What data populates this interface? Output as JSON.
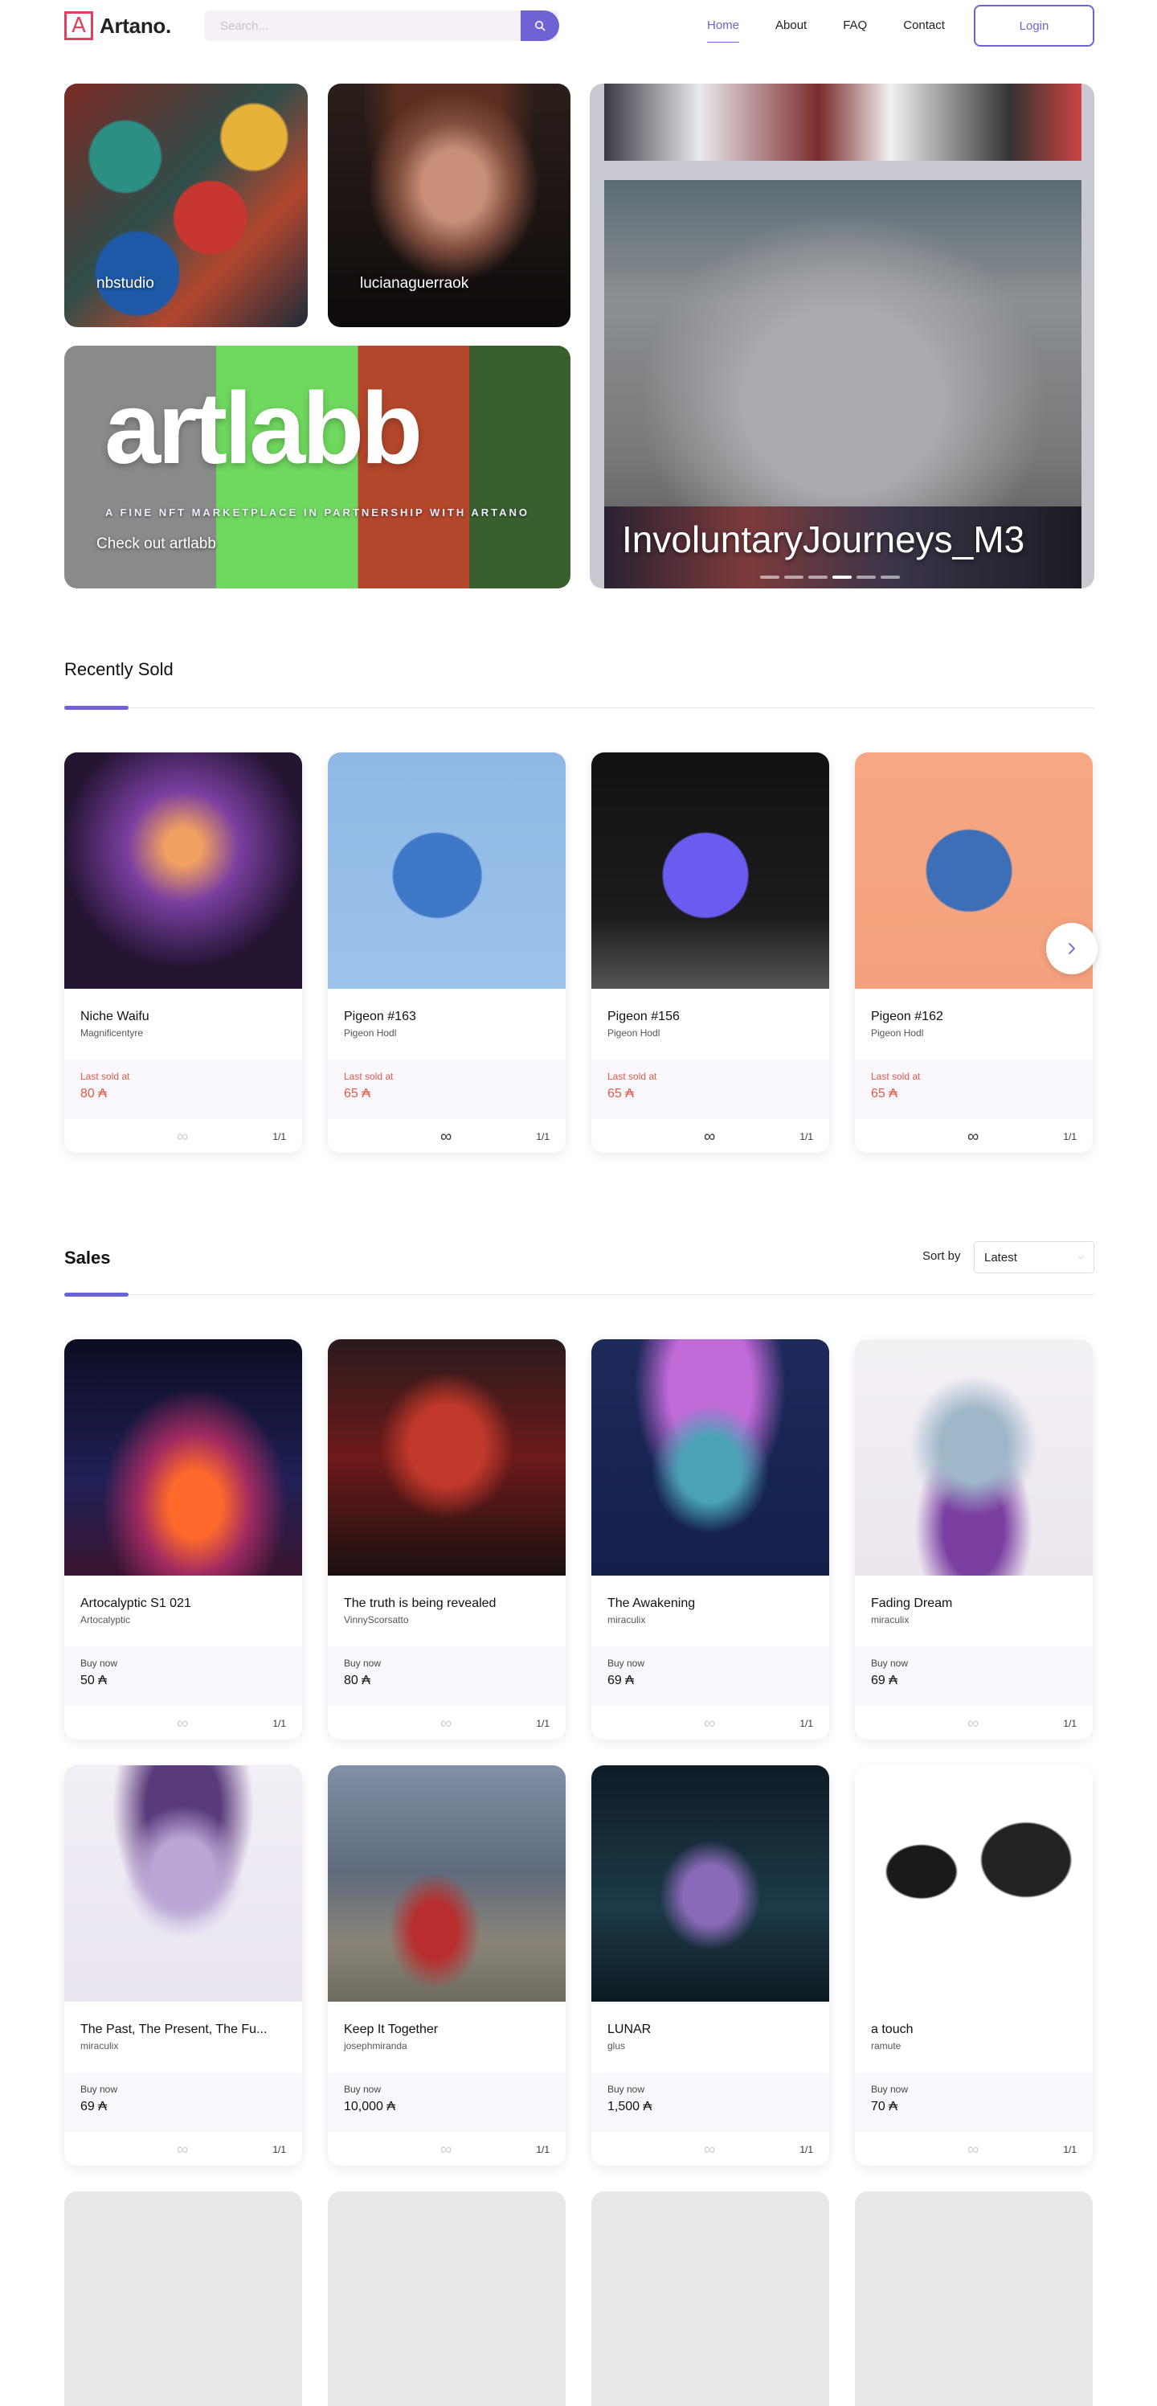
{
  "header": {
    "logo_mark": "A",
    "logo_text": "Artano.",
    "search_placeholder": "Search...",
    "nav": [
      "Home",
      "About",
      "FAQ",
      "Contact"
    ],
    "active_nav": "Home",
    "login_label": "Login"
  },
  "hero": {
    "tiles": [
      "nbstudio",
      "lucianaguerraok"
    ],
    "artlabb": {
      "big_text": "artlabb",
      "subtitle": "A FINE NFT MARKETPLACE IN PARTNERSHIP WITH ARTANO",
      "cta": "Check out artlabb"
    },
    "featured_title": "InvoluntaryJourneys_M3"
  },
  "recently_sold": {
    "title": "Recently Sold",
    "items": [
      {
        "name": "Niche Waifu",
        "creator": "Magnificentyre",
        "label": "Last sold at",
        "price": "80 ₳",
        "edition": "1/1"
      },
      {
        "name": "Pigeon #163",
        "creator": "Pigeon Hodl",
        "label": "Last sold at",
        "price": "65 ₳",
        "edition": "1/1"
      },
      {
        "name": "Pigeon #156",
        "creator": "Pigeon Hodl",
        "label": "Last sold at",
        "price": "65 ₳",
        "edition": "1/1"
      },
      {
        "name": "Pigeon #162",
        "creator": "Pigeon Hodl",
        "label": "Last sold at",
        "price": "65 ₳",
        "edition": "1/1"
      }
    ]
  },
  "sales": {
    "title": "Sales",
    "sort_label": "Sort by",
    "sort_value": "Latest",
    "items": [
      {
        "name": "Artocalyptic S1 021",
        "creator": "Artocalyptic",
        "label": "Buy now",
        "price": "50 ₳",
        "edition": "1/1"
      },
      {
        "name": "The truth is being revealed",
        "creator": "VinnyScorsatto",
        "label": "Buy now",
        "price": "80 ₳",
        "edition": "1/1"
      },
      {
        "name": "The Awakening",
        "creator": "miraculix",
        "label": "Buy now",
        "price": "69 ₳",
        "edition": "1/1"
      },
      {
        "name": "Fading Dream",
        "creator": "miraculix",
        "label": "Buy now",
        "price": "69 ₳",
        "edition": "1/1"
      },
      {
        "name": "The Past, The Present, The Fu...",
        "creator": "miraculix",
        "label": "Buy now",
        "price": "69 ₳",
        "edition": "1/1"
      },
      {
        "name": "Keep It Together",
        "creator": "josephmiranda",
        "label": "Buy now",
        "price": "10,000 ₳",
        "edition": "1/1"
      },
      {
        "name": "LUNAR",
        "creator": "glus",
        "label": "Buy now",
        "price": "1,500 ₳",
        "edition": "1/1"
      },
      {
        "name": "a touch",
        "creator": "ramute",
        "label": "Buy now",
        "price": "70 ₳",
        "edition": "1/1"
      }
    ]
  },
  "icons": {
    "edition_icon": "∞",
    "search_icon": "search-icon",
    "next_icon": "chevron-right-icon"
  },
  "colors": {
    "accent": "#6e63d5",
    "sold_price": "#e05a47",
    "logo": "#e0405f"
  }
}
